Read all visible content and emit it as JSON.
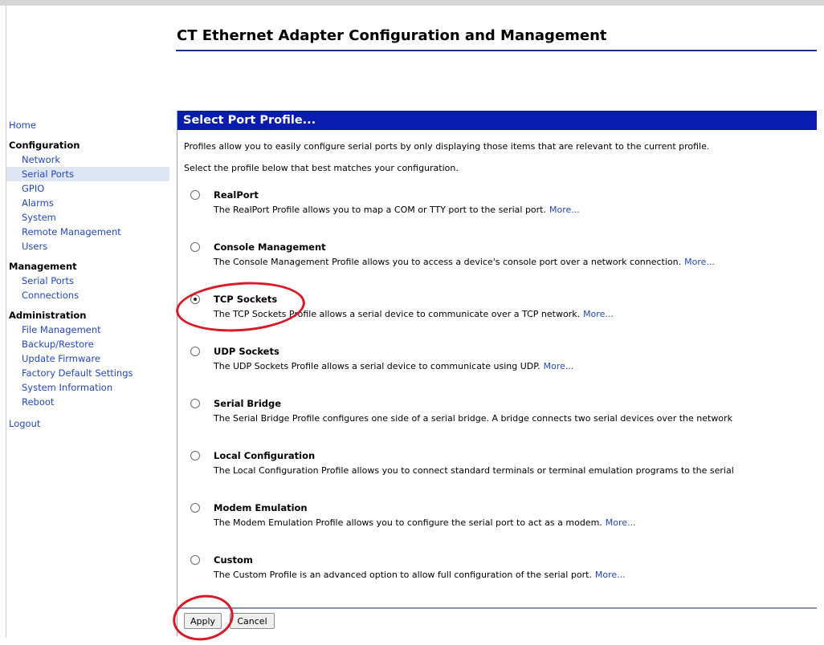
{
  "page_title": "CT Ethernet Adapter Configuration and Management",
  "sidebar": {
    "home": "Home",
    "configuration": {
      "heading": "Configuration",
      "items": [
        "Network",
        "Serial Ports",
        "GPIO",
        "Alarms",
        "System",
        "Remote Management",
        "Users"
      ]
    },
    "management": {
      "heading": "Management",
      "items": [
        "Serial Ports",
        "Connections"
      ]
    },
    "administration": {
      "heading": "Administration",
      "items": [
        "File Management",
        "Backup/Restore",
        "Update Firmware",
        "Factory Default Settings",
        "System Information",
        "Reboot"
      ]
    },
    "logout": "Logout",
    "active_item": "Serial Ports"
  },
  "panel": {
    "title": "Select Port Profile...",
    "intro1": "Profiles allow you to easily configure serial ports by only displaying those items that are relevant to the current profile.",
    "intro2": "Select the profile below that best matches your configuration.",
    "profiles": [
      {
        "name": "RealPort",
        "desc": "The RealPort Profile allows you to map a COM or TTY port to the serial port.",
        "more": "More...",
        "selected": false
      },
      {
        "name": "Console Management",
        "desc": "The Console Management Profile allows you to access a device's console port over a network connection.",
        "more": "More...",
        "selected": false
      },
      {
        "name": "TCP Sockets",
        "desc": "The TCP Sockets Profile allows a serial device to communicate over a TCP network.",
        "more": "More...",
        "selected": true
      },
      {
        "name": "UDP Sockets",
        "desc": "The UDP Sockets Profile allows a serial device to communicate using UDP.",
        "more": "More...",
        "selected": false
      },
      {
        "name": "Serial Bridge",
        "desc": "The Serial Bridge Profile configures one side of a serial bridge. A bridge connects two serial devices over the network",
        "more": "",
        "selected": false
      },
      {
        "name": "Local Configuration",
        "desc": "The Local Configuration Profile allows you to connect standard terminals or terminal emulation programs to the serial",
        "more": "",
        "selected": false
      },
      {
        "name": "Modem Emulation",
        "desc": "The Modem Emulation Profile allows you to configure the serial port to act as a modem.",
        "more": "More...",
        "selected": false
      },
      {
        "name": "Custom",
        "desc": "The Custom Profile is an advanced option to allow full configuration of the serial port.",
        "more": "More...",
        "selected": false
      }
    ]
  },
  "buttons": {
    "apply": "Apply",
    "cancel": "Cancel"
  },
  "colors": {
    "header_bg": "#0a1bb0",
    "link": "#2447b8",
    "annotation": "#d71a28"
  }
}
